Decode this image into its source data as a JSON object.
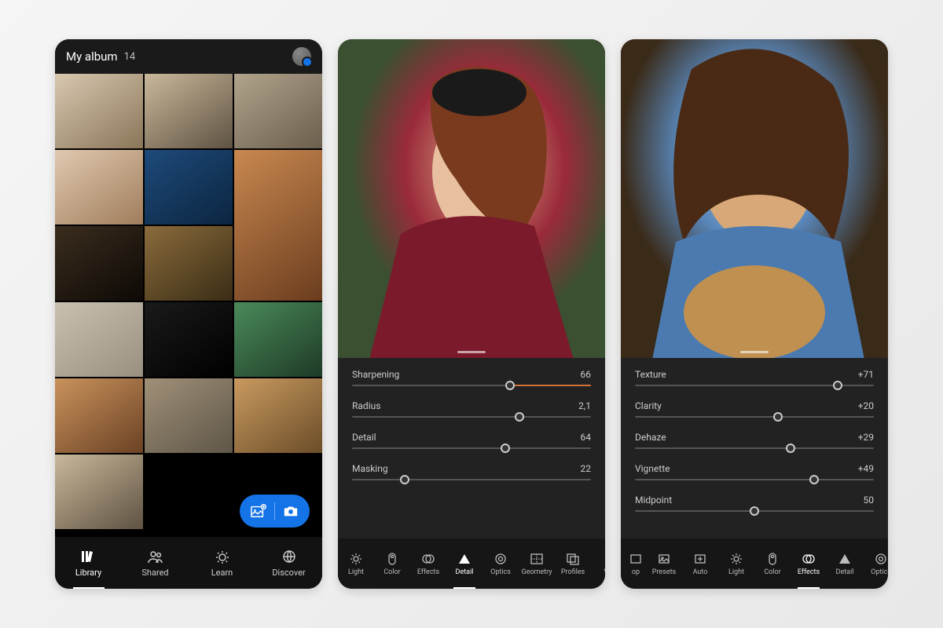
{
  "library": {
    "title": "My album",
    "count": "14",
    "nav": {
      "library": "Library",
      "shared": "Shared",
      "learn": "Learn",
      "discover": "Discover",
      "active": "library"
    }
  },
  "detail_panel": {
    "sliders": [
      {
        "label": "Sharpening",
        "value": "66",
        "pct": 66
      },
      {
        "label": "Radius",
        "value": "2,1",
        "pct": 70
      },
      {
        "label": "Detail",
        "value": "64",
        "pct": 64
      },
      {
        "label": "Masking",
        "value": "22",
        "pct": 22
      }
    ],
    "tools": [
      "Light",
      "Color",
      "Effects",
      "Detail",
      "Optics",
      "Geometry",
      "Profiles",
      "Ver"
    ],
    "active_tool": "Detail"
  },
  "effects_panel": {
    "sliders": [
      {
        "label": "Texture",
        "value": "+71",
        "pct": 85
      },
      {
        "label": "Clarity",
        "value": "+20",
        "pct": 60
      },
      {
        "label": "Dehaze",
        "value": "+29",
        "pct": 65
      },
      {
        "label": "Vignette",
        "value": "+49",
        "pct": 75
      },
      {
        "label": "Midpoint",
        "value": "50",
        "pct": 50
      }
    ],
    "tools_left": "op",
    "tools": [
      "Presets",
      "Auto",
      "Light",
      "Color",
      "Effects",
      "Detail",
      "Optics"
    ],
    "active_tool": "Effects"
  }
}
